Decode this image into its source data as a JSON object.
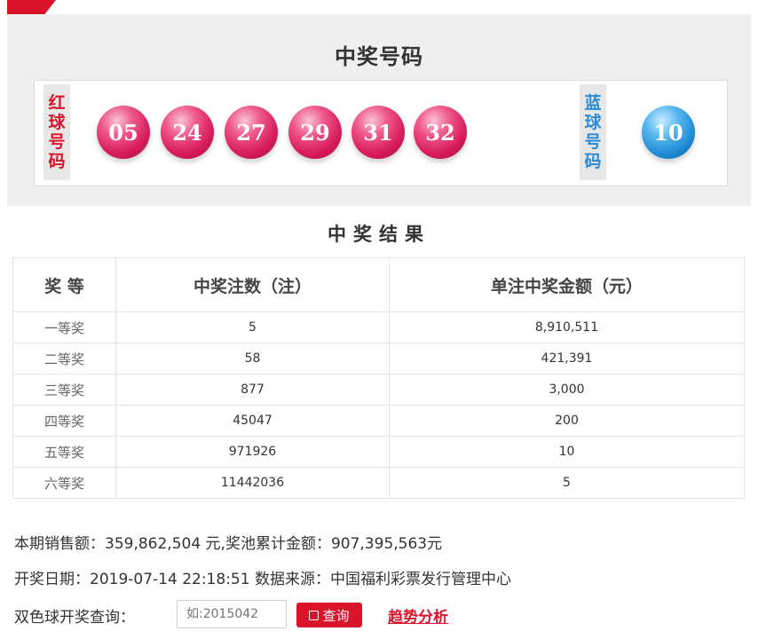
{
  "colors": {
    "accent_red": "#d9142b",
    "blue_label": "#2a8cd8",
    "panel_bg": "#efefef"
  },
  "draw": {
    "title": "中奖号码",
    "red_label": [
      "红",
      "球",
      "号",
      "码"
    ],
    "blue_label": [
      "蓝",
      "球",
      "号",
      "码"
    ],
    "red_balls": [
      "05",
      "24",
      "27",
      "29",
      "31",
      "32"
    ],
    "blue_balls": [
      "10"
    ]
  },
  "results": {
    "title": "中奖结果",
    "headers": [
      "奖 等",
      "中奖注数（注）",
      "单注中奖金额（元）"
    ],
    "rows": [
      [
        "一等奖",
        "5",
        "8,910,511"
      ],
      [
        "二等奖",
        "58",
        "421,391"
      ],
      [
        "三等奖",
        "877",
        "3,000"
      ],
      [
        "四等奖",
        "45047",
        "200"
      ],
      [
        "五等奖",
        "971926",
        "10"
      ],
      [
        "六等奖",
        "11442036",
        "5"
      ]
    ]
  },
  "info": {
    "sales_line": "本期销售额：359,862,504 元,奖池累计金额：907,395,563元",
    "date_line": "开奖日期：2019-07-14 22:18:51 数据来源：中国福利彩票发行管理中心"
  },
  "query": {
    "label": "双色球开奖查询：",
    "placeholder": "如:2015042",
    "button": "查询",
    "trend_link": "趋势分析"
  }
}
